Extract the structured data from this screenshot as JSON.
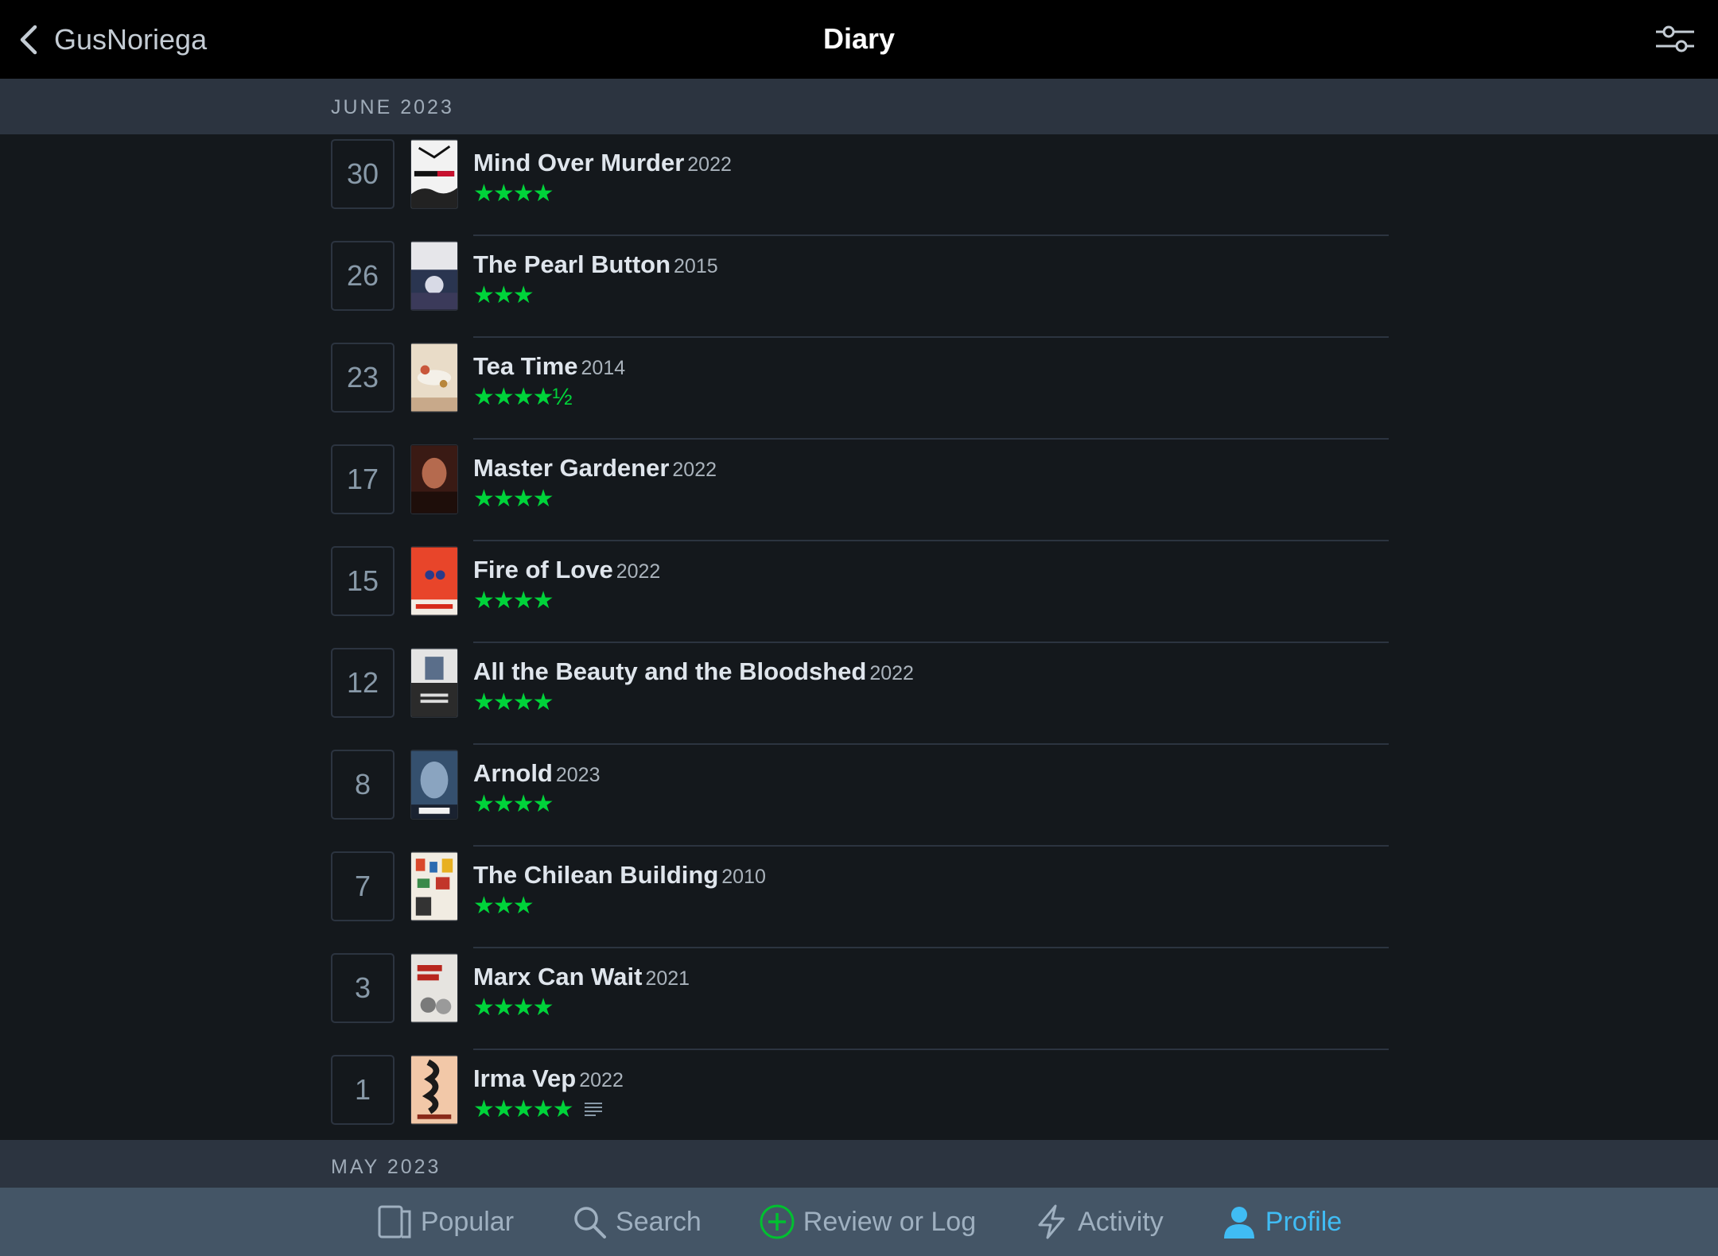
{
  "header": {
    "back_label": "GusNoriega",
    "title": "Diary"
  },
  "months": [
    {
      "label": "JUNE 2023"
    },
    {
      "label": "MAY 2023"
    }
  ],
  "entries": [
    {
      "day": "30",
      "title": "Mind Over Murder",
      "year": "2022",
      "rating_text": "★★★★",
      "rating": 4,
      "has_review": false
    },
    {
      "day": "26",
      "title": "The Pearl Button",
      "year": "2015",
      "rating_text": "★★★",
      "rating": 3,
      "has_review": false
    },
    {
      "day": "23",
      "title": "Tea Time",
      "year": "2014",
      "rating_text": "★★★★½",
      "rating": 4.5,
      "has_review": false
    },
    {
      "day": "17",
      "title": "Master Gardener",
      "year": "2022",
      "rating_text": "★★★★",
      "rating": 4,
      "has_review": false
    },
    {
      "day": "15",
      "title": "Fire of Love",
      "year": "2022",
      "rating_text": "★★★★",
      "rating": 4,
      "has_review": false
    },
    {
      "day": "12",
      "title": "All the Beauty and the Bloodshed",
      "year": "2022",
      "rating_text": "★★★★",
      "rating": 4,
      "has_review": false
    },
    {
      "day": "8",
      "title": "Arnold",
      "year": "2023",
      "rating_text": "★★★★",
      "rating": 4,
      "has_review": false
    },
    {
      "day": "7",
      "title": "The Chilean Building",
      "year": "2010",
      "rating_text": "★★★",
      "rating": 3,
      "has_review": false
    },
    {
      "day": "3",
      "title": "Marx Can Wait",
      "year": "2021",
      "rating_text": "★★★★",
      "rating": 4,
      "has_review": false
    },
    {
      "day": "1",
      "title": "Irma Vep",
      "year": "2022",
      "rating_text": "★★★★★",
      "rating": 5,
      "has_review": true
    }
  ],
  "tabs": [
    {
      "label": "Popular",
      "icon": "popular-icon"
    },
    {
      "label": "Search",
      "icon": "search-icon"
    },
    {
      "label": "Review or Log",
      "icon": "plus-circle-icon"
    },
    {
      "label": "Activity",
      "icon": "lightning-icon"
    },
    {
      "label": "Profile",
      "icon": "profile-icon"
    }
  ],
  "colors": {
    "accent_blue": "#40bcf4",
    "star_green": "#00d33a",
    "plus_green": "#00c030",
    "header_band": "#2c3440",
    "tabbar": "#445566"
  }
}
